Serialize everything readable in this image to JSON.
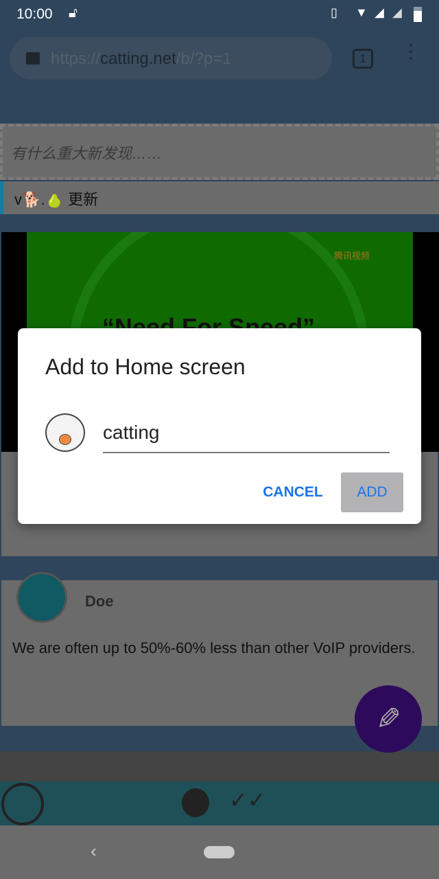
{
  "status_bar": {
    "time": "10:00"
  },
  "browser": {
    "url_prefix": "https://",
    "url_domain": "catting.net",
    "url_path": "/b/?p=1",
    "tab_count": "1"
  },
  "composer": {
    "placeholder": "有什么重大新发现……"
  },
  "version_bar": {
    "prefix": "v",
    "emoji1": "🐕",
    "dot": ".",
    "emoji2": "🍐",
    "label": "更新"
  },
  "video": {
    "title": "“Need For Speed”",
    "watermark": "腾讯视频"
  },
  "dialog": {
    "title": "Add to Home screen",
    "name_value": "catting",
    "cancel_label": "CANCEL",
    "add_label": "ADD"
  },
  "post": {
    "author": "Doe",
    "text": "We are often up to 50%-60% less than other VoIP providers."
  },
  "colors": {
    "accent": "#1a73e8",
    "fab": "#2e0a5c",
    "bottom_bar": "#1f5058"
  }
}
